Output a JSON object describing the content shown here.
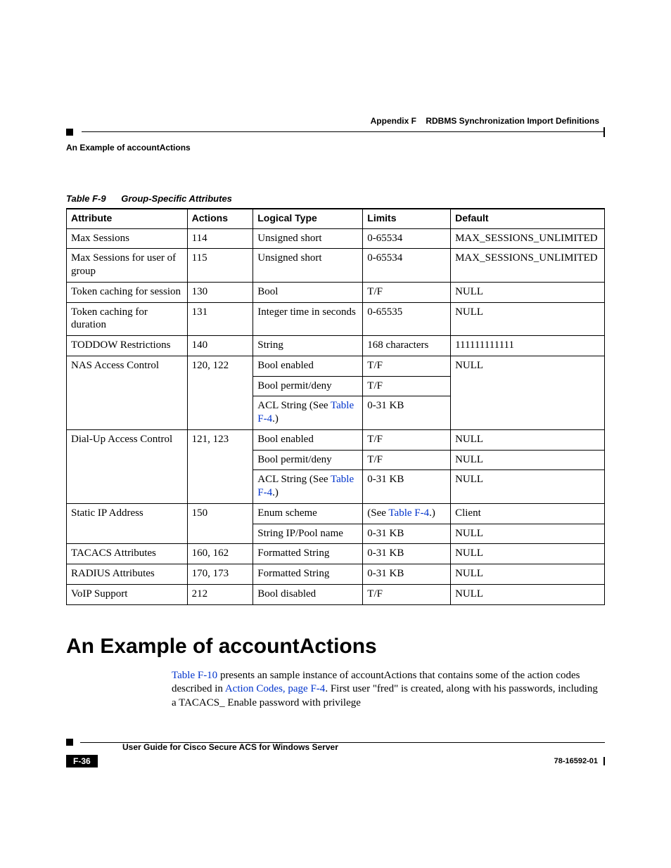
{
  "header": {
    "appendix": "Appendix F",
    "appendix_title": "RDBMS Synchronization Import Definitions",
    "section_tag": "An Example of accountActions"
  },
  "table": {
    "number": "Table F-9",
    "title": "Group-Specific Attributes",
    "headers": {
      "attribute": "Attribute",
      "actions": "Actions",
      "logical_type": "Logical Type",
      "limits": "Limits",
      "default": "Default"
    },
    "rows": {
      "r1": {
        "attribute": "Max Sessions",
        "actions": "114",
        "logical_type": "Unsigned short",
        "limits": "0-65534",
        "default": "MAX_SESSIONS_UNLIMITED"
      },
      "r2": {
        "attribute": "Max Sessions for user of group",
        "actions": "115",
        "logical_type": "Unsigned short",
        "limits": "0-65534",
        "default": "MAX_SESSIONS_UNLIMITED"
      },
      "r3": {
        "attribute": "Token caching for session",
        "actions": "130",
        "logical_type": "Bool",
        "limits": "T/F",
        "default": "NULL"
      },
      "r4": {
        "attribute": "Token caching for duration",
        "actions": "131",
        "logical_type": "Integer time in seconds",
        "limits": "0-65535",
        "default": "NULL"
      },
      "r5": {
        "attribute": "TODDOW Restrictions",
        "actions": "140",
        "logical_type": "String",
        "limits": "168 characters",
        "default": "111111111111"
      },
      "r6": {
        "attribute": "NAS Access Control",
        "actions": "120, 122",
        "sub1": {
          "logical_type": "Bool enabled",
          "limits": "T/F"
        },
        "sub2": {
          "logical_type": "Bool permit/deny",
          "limits": "T/F"
        },
        "sub3": {
          "logical_type_pre": "ACL String (See ",
          "logical_type_link": "Table F-4",
          "logical_type_post": ".)",
          "limits": "0-31 KB"
        },
        "default": "NULL"
      },
      "r7": {
        "attribute": "Dial-Up Access Control",
        "actions": "121, 123",
        "sub1": {
          "logical_type": "Bool enabled",
          "limits": "T/F",
          "default": "NULL"
        },
        "sub2": {
          "logical_type": "Bool permit/deny",
          "limits": "T/F",
          "default": "NULL"
        },
        "sub3": {
          "logical_type_pre": "ACL String (See ",
          "logical_type_link": "Table F-4",
          "logical_type_post": ".)",
          "limits": "0-31 KB",
          "default": "NULL"
        }
      },
      "r8": {
        "attribute": "Static IP Address",
        "actions": "150",
        "sub1": {
          "logical_type": "Enum scheme",
          "limits_pre": "(See ",
          "limits_link": "Table F-4",
          "limits_post": ".)",
          "default": "Client"
        },
        "sub2": {
          "logical_type": "String IP/Pool name",
          "limits": "0-31 KB",
          "default": "NULL"
        }
      },
      "r9": {
        "attribute": "TACACS Attributes",
        "actions": "160, 162",
        "logical_type": "Formatted String",
        "limits": "0-31 KB",
        "default": "NULL"
      },
      "r10": {
        "attribute": "RADIUS Attributes",
        "actions": "170, 173",
        "logical_type": "Formatted String",
        "limits": "0-31 KB",
        "default": "NULL"
      },
      "r11": {
        "attribute": "VoIP Support",
        "actions": "212",
        "logical_type": "Bool disabled",
        "limits": "T/F",
        "default": "NULL"
      }
    }
  },
  "section": {
    "heading": "An Example of accountActions",
    "para": {
      "link1": "Table F-10",
      "text1": " presents an sample instance of accountActions that contains some of the action codes described in ",
      "link2": "Action Codes, page F-4",
      "text2": ". First user \"fred\" is created, along with his passwords, including a TACACS_ Enable password with privilege"
    }
  },
  "footer": {
    "guide": "User Guide for Cisco Secure ACS for Windows Server",
    "page": "F-36",
    "docid": "78-16592-01"
  }
}
